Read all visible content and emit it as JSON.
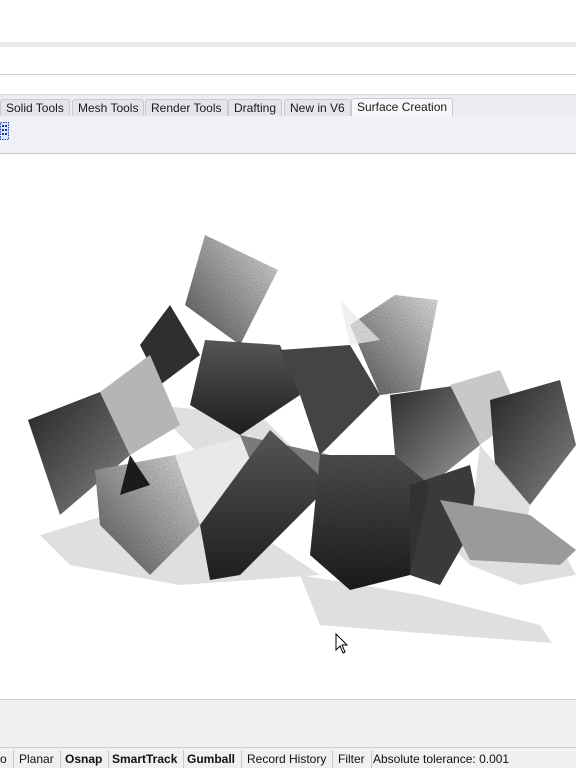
{
  "tabs": [
    {
      "label": "Solid Tools",
      "active": false
    },
    {
      "label": "Mesh Tools",
      "active": false
    },
    {
      "label": "Render Tools",
      "active": false
    },
    {
      "label": "Drafting",
      "active": false
    },
    {
      "label": "New in V6",
      "active": false
    },
    {
      "label": "Surface Creation",
      "active": true
    }
  ],
  "toolbar": {
    "icon": "grid-select-icon"
  },
  "viewport": {
    "content": "faceted-surface-sculpture",
    "cursor": "arrow-cursor-icon"
  },
  "statusbar": {
    "partial_left": "o",
    "planar": "Planar",
    "osnap": "Osnap",
    "smarttrack": "SmartTrack",
    "gumball": "Gumball",
    "record_history": "Record History",
    "filter": "Filter",
    "tolerance": "Absolute tolerance: 0.001"
  },
  "colors": {
    "tabbar": "#eceef2",
    "statusbar": "#f0f0f0",
    "accent": "#2b4bb8"
  }
}
